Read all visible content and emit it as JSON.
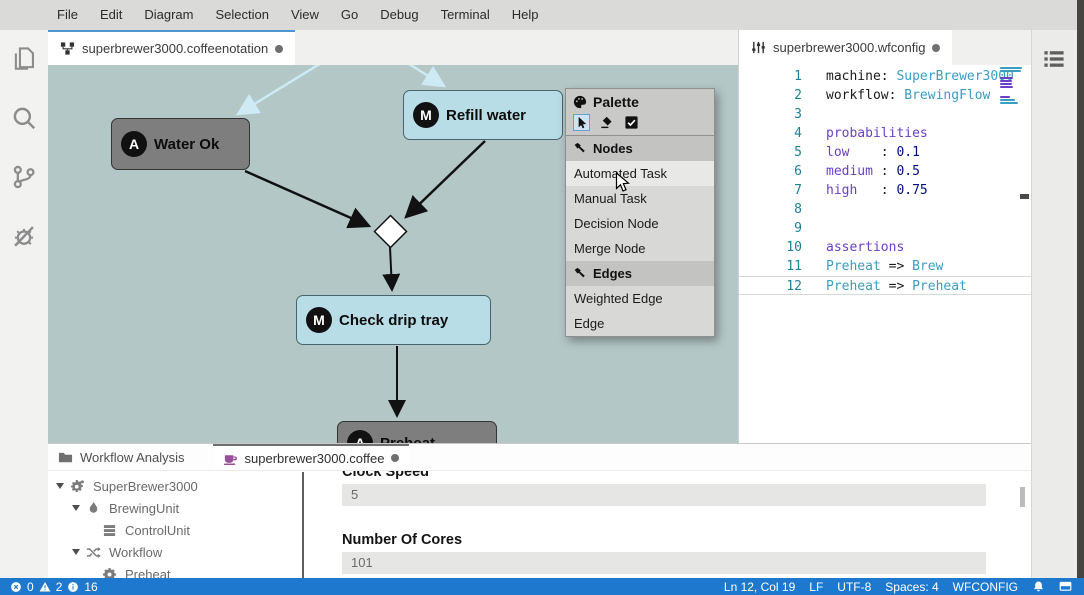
{
  "window": {
    "menu_items": [
      "File",
      "Edit",
      "Diagram",
      "Selection",
      "View",
      "Go",
      "Debug",
      "Terminal",
      "Help"
    ]
  },
  "activity_bar": {
    "icons": [
      "files",
      "search",
      "source-control",
      "debug"
    ]
  },
  "right_sidebar": {
    "icons": [
      "outline"
    ]
  },
  "diagram": {
    "tab": {
      "icon": "graph",
      "label": "superbrewer3000.coffeenotation",
      "dirty": true
    },
    "nodes": [
      {
        "badge": "A",
        "label": "Water Ok",
        "kind": "automated"
      },
      {
        "badge": "M",
        "label": "Refill water",
        "kind": "manual"
      },
      {
        "badge": "M",
        "label": "Check drip tray",
        "kind": "manual"
      },
      {
        "badge": "A",
        "label": "Preheat",
        "kind": "automated"
      }
    ],
    "edges": [
      {
        "from": "offscreen-top",
        "to": "Water Ok",
        "style": "light"
      },
      {
        "from": "offscreen-top",
        "to": "Refill water",
        "style": "light"
      },
      {
        "from": "Water Ok",
        "to": "decision",
        "style": "solid"
      },
      {
        "from": "Refill water",
        "to": "decision",
        "style": "solid"
      },
      {
        "from": "decision",
        "to": "Check drip tray",
        "style": "solid"
      },
      {
        "from": "Check drip tray",
        "to": "Preheat",
        "style": "solid"
      }
    ],
    "palette": {
      "title": "Palette",
      "tools": [
        {
          "icon": "cursor",
          "name": "selection-tool",
          "active": true
        },
        {
          "icon": "marquee",
          "name": "marquee-tool",
          "active": false
        },
        {
          "icon": "check-square",
          "name": "validation-tool",
          "active": false
        }
      ],
      "sections": [
        {
          "icon": "hammer",
          "label": "Nodes",
          "items": [
            "Automated Task",
            "Manual Task",
            "Decision Node",
            "Merge Node"
          ]
        },
        {
          "icon": "hammer",
          "label": "Edges",
          "items": [
            "Weighted Edge",
            "Edge"
          ]
        }
      ],
      "hovered_item": "Automated Task"
    }
  },
  "editor": {
    "tab": {
      "icon": "sliders",
      "label": "superbrewer3000.wfconfig",
      "dirty": true
    },
    "colors": {
      "plain": "#1a1a1a",
      "keyword": "#6b3fc8",
      "type": "#3a9dc2",
      "number": "#001080",
      "line_number": "#1b8198"
    },
    "lines": [
      {
        "n": 1,
        "tokens": [
          [
            "plain",
            "machine: "
          ],
          [
            "type",
            "SuperBrewer3000"
          ]
        ]
      },
      {
        "n": 2,
        "tokens": [
          [
            "plain",
            "workflow: "
          ],
          [
            "type",
            "BrewingFlow"
          ]
        ]
      },
      {
        "n": 3,
        "tokens": []
      },
      {
        "n": 4,
        "tokens": [
          [
            "keyword",
            "probabilities"
          ]
        ]
      },
      {
        "n": 5,
        "tokens": [
          [
            "keyword",
            "low"
          ],
          [
            "plain",
            "    : "
          ],
          [
            "number",
            "0.1"
          ]
        ]
      },
      {
        "n": 6,
        "tokens": [
          [
            "keyword",
            "medium"
          ],
          [
            "plain",
            " : "
          ],
          [
            "number",
            "0.5"
          ]
        ]
      },
      {
        "n": 7,
        "tokens": [
          [
            "keyword",
            "high"
          ],
          [
            "plain",
            "   : "
          ],
          [
            "number",
            "0.75"
          ]
        ]
      },
      {
        "n": 8,
        "tokens": []
      },
      {
        "n": 9,
        "tokens": []
      },
      {
        "n": 10,
        "tokens": [
          [
            "keyword",
            "assertions"
          ]
        ]
      },
      {
        "n": 11,
        "tokens": [
          [
            "type",
            "Preheat"
          ],
          [
            "plain",
            " => "
          ],
          [
            "type",
            "Brew"
          ]
        ]
      },
      {
        "n": 12,
        "tokens": [
          [
            "type",
            "Preheat"
          ],
          [
            "plain",
            " => "
          ],
          [
            "type",
            "Preheat"
          ]
        ],
        "current": true
      }
    ]
  },
  "bottom_panel": {
    "tabs": [
      {
        "icon": "folder",
        "label": "Workflow Analysis",
        "dirty": false,
        "active": false
      },
      {
        "icon": "coffee",
        "label": "superbrewer3000.coffee",
        "dirty": true,
        "active": true
      }
    ],
    "tree": [
      {
        "icon": "cogs",
        "label": "SuperBrewer3000",
        "level": 0,
        "expandable": true
      },
      {
        "icon": "flame",
        "label": "BrewingUnit",
        "level": 1,
        "expandable": true
      },
      {
        "icon": "server",
        "label": "ControlUnit",
        "level": 2,
        "expandable": false
      },
      {
        "icon": "shuffle",
        "label": "Workflow",
        "level": 1,
        "expandable": true
      },
      {
        "icon": "cog",
        "label": "Preheat",
        "level": 2,
        "expandable": false
      }
    ],
    "form": {
      "fields": [
        {
          "label": "Clock Speed",
          "value": "5"
        },
        {
          "label": "Number Of Cores",
          "value": "101"
        }
      ]
    }
  },
  "status_bar": {
    "errors": "0",
    "warnings": "2",
    "infos": "16",
    "cursor_position": "Ln 12, Col 19",
    "eol": "LF",
    "encoding": "UTF-8",
    "indentation": "Spaces: 4",
    "language": "WFCONFIG"
  },
  "colors": {
    "canvas_bg": "#b4c7c7",
    "node_blue": "#b9dde6",
    "node_gray": "#7e7e7e",
    "edge_light": "#cdeaf5",
    "edge_dark": "#111111",
    "tab_accent": "#4d96d3",
    "statusbar_bg": "#1e79ce",
    "coffee_icon": "#9a4f9d"
  }
}
